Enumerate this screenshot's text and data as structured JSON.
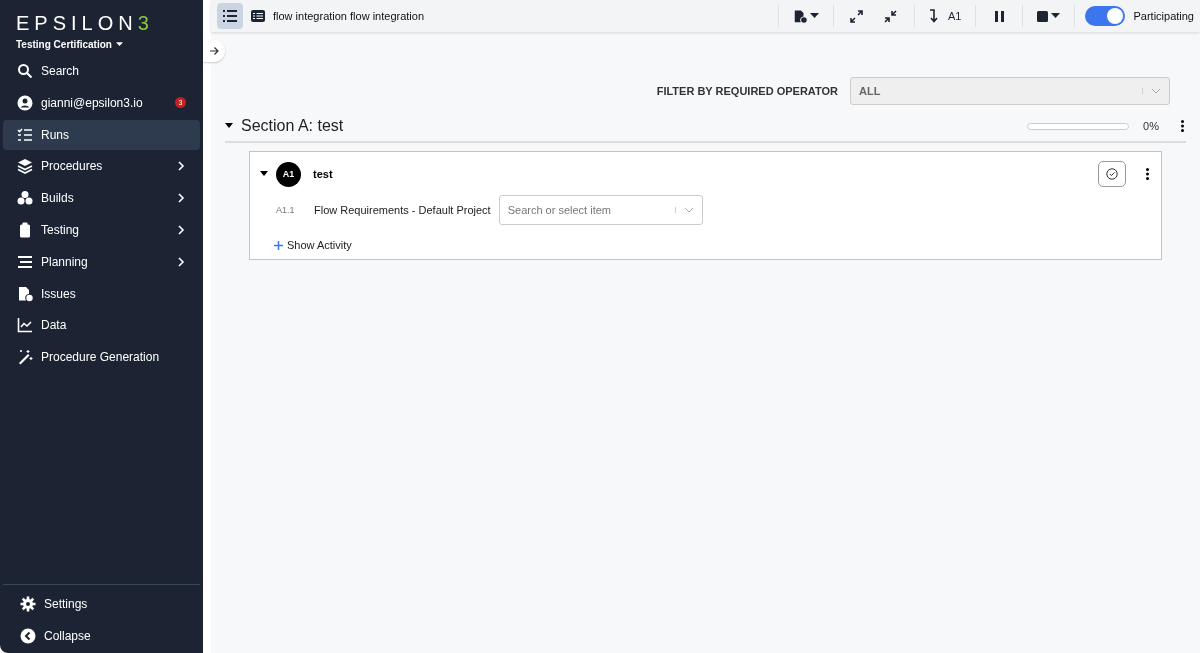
{
  "sidebar": {
    "logo": {
      "word": "EPSILON",
      "mark": "3"
    },
    "workspace": "Testing Certification",
    "items": [
      {
        "kind": "search",
        "label": "Search",
        "selected": false,
        "submenu": false
      },
      {
        "kind": "user",
        "label": "gianni@epsilon3.io",
        "selected": false,
        "submenu": false,
        "badge": "3"
      },
      {
        "kind": "runs",
        "label": "Runs",
        "selected": true,
        "submenu": false
      },
      {
        "kind": "procedures",
        "label": "Procedures",
        "selected": false,
        "submenu": true
      },
      {
        "kind": "builds",
        "label": "Builds",
        "selected": false,
        "submenu": true
      },
      {
        "kind": "testing",
        "label": "Testing",
        "selected": false,
        "submenu": true
      },
      {
        "kind": "planning",
        "label": "Planning",
        "selected": false,
        "submenu": true
      },
      {
        "kind": "issues",
        "label": "Issues",
        "selected": false,
        "submenu": false
      },
      {
        "kind": "data",
        "label": "Data",
        "selected": false,
        "submenu": false
      },
      {
        "kind": "generation",
        "label": "Procedure Generation",
        "selected": false,
        "submenu": false
      }
    ],
    "footer": [
      {
        "kind": "settings",
        "label": "Settings"
      },
      {
        "kind": "collapse",
        "label": "Collapse"
      }
    ]
  },
  "toolbar": {
    "title": "flow integration flow integration",
    "jump_label": "A1",
    "participating": {
      "label": "Participating",
      "on": true
    }
  },
  "filter": {
    "label": "FILTER BY REQUIRED OPERATOR",
    "value": "ALL"
  },
  "section": {
    "title": "Section A: test",
    "expanded": true,
    "progress": {
      "level": 0,
      "reading": "0%"
    },
    "steps": [
      {
        "badge": "A1",
        "title": "test",
        "expanded": true,
        "fields": [
          {
            "id": "A1.1",
            "label": "Flow Requirements - Default Project",
            "placeholder": "Search or select item"
          }
        ],
        "activity_link": "Show Activity"
      }
    ]
  }
}
